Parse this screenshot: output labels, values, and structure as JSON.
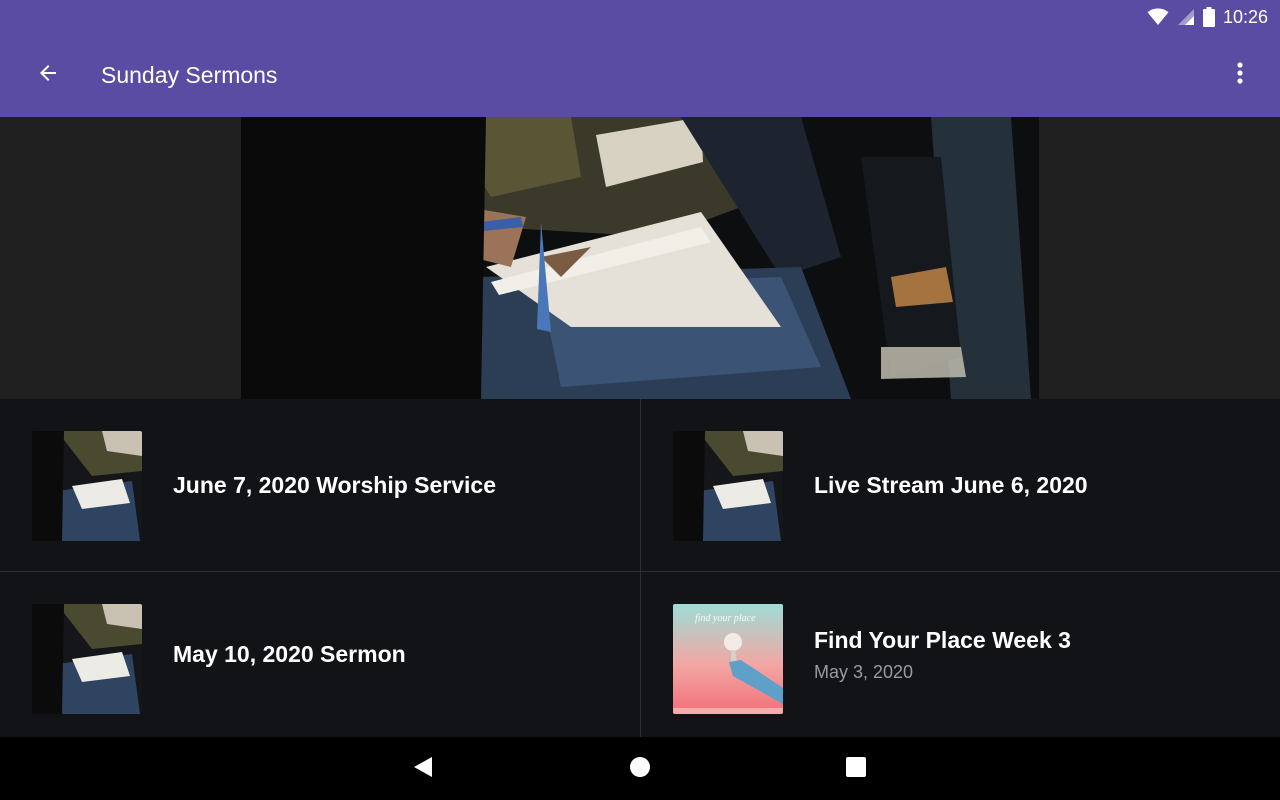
{
  "status_bar": {
    "time": "10:26",
    "icons": [
      "wifi-icon",
      "cell-signal-icon",
      "battery-icon"
    ]
  },
  "app_bar": {
    "title": "Sunday Sermons",
    "back_icon": "arrow-back-icon",
    "menu_icon": "more-vert-icon"
  },
  "colors": {
    "app_bar": "#5b4ca3",
    "list_background": "#121316",
    "hero_background": "#202020",
    "subtitle": "#9a9aa0"
  },
  "sermons": [
    {
      "title": "June 7, 2020 Worship Service",
      "subtitle": "",
      "thumbnail": "church-notebook-photo"
    },
    {
      "title": "Live Stream June 6, 2020",
      "subtitle": "",
      "thumbnail": "church-notebook-photo"
    },
    {
      "title": "May 10, 2020 Sermon",
      "subtitle": "",
      "thumbnail": "church-notebook-photo"
    },
    {
      "title": "Find Your Place Week 3",
      "subtitle": "May 3, 2020",
      "thumbnail": "find-your-place-artwork",
      "thumbnail_text": "find your place"
    }
  ],
  "nav_bar": {
    "back": "nav-back-icon",
    "home": "nav-home-icon",
    "recents": "nav-recents-icon"
  }
}
